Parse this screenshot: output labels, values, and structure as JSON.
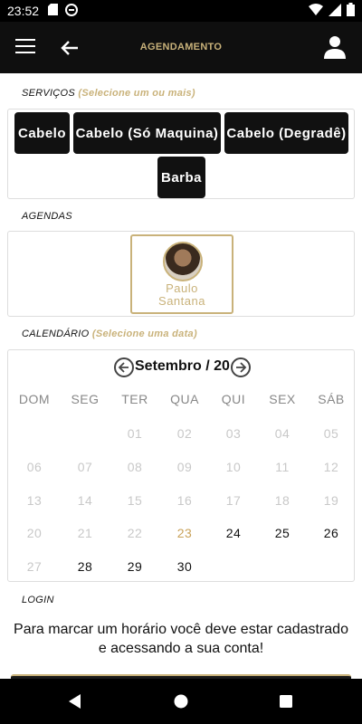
{
  "status_bar": {
    "time": "23:52"
  },
  "app_bar": {
    "title": "AGENDAMENTO"
  },
  "services": {
    "label": "SERVIÇOS",
    "hint": "(Selecione um ou mais)",
    "items": [
      "Cabelo",
      "Cabelo (Só Maquina)",
      "Cabelo (Degradê)",
      "Barba"
    ]
  },
  "agendas": {
    "label": "AGENDAS",
    "professional": {
      "first": "Paulo",
      "last": "Santana"
    }
  },
  "calendar": {
    "label": "CALENDÁRIO",
    "hint": "(Selecione uma data)",
    "month": "Setembro / 20",
    "weekdays": [
      "DOM",
      "SEG",
      "TER",
      "QUA",
      "QUI",
      "SEX",
      "SÁB"
    ],
    "weeks": [
      [
        "",
        "",
        "01",
        "02",
        "03",
        "04",
        "05"
      ],
      [
        "06",
        "07",
        "08",
        "09",
        "10",
        "11",
        "12"
      ],
      [
        "13",
        "14",
        "15",
        "16",
        "17",
        "18",
        "19"
      ],
      [
        "20",
        "21",
        "22",
        "23",
        "24",
        "25",
        "26"
      ],
      [
        "27",
        "28",
        "29",
        "30",
        "",
        "",
        ""
      ]
    ],
    "today": "23",
    "available": [
      "24",
      "25",
      "26",
      "28",
      "29",
      "30"
    ]
  },
  "login": {
    "label": "LOGIN",
    "message": "Para marcar um horário você deve estar cadastrado e acessando a sua conta!"
  },
  "colors": {
    "accent": "#c9b27a",
    "dark": "#111111",
    "disabled": "#c8c8c8"
  }
}
